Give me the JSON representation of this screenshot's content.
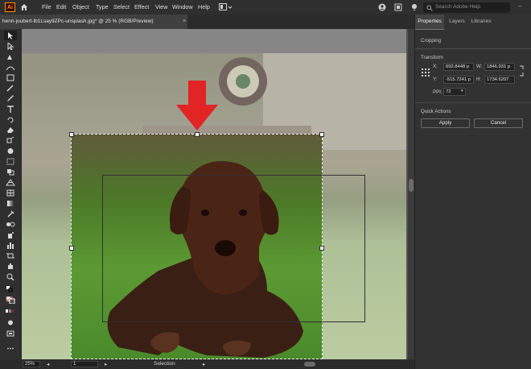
{
  "app": {
    "logo": "Ai"
  },
  "menu": [
    "File",
    "Edit",
    "Object",
    "Type",
    "Select",
    "Effect",
    "View",
    "Window",
    "Help"
  ],
  "search": {
    "placeholder": "Search Adobe Help"
  },
  "document": {
    "tab_title": "henri-joubert-lb1Lsay9ZPc-unsplash.jpg* @ 25 % (RGB/Preview)",
    "close": "×"
  },
  "status": {
    "zoom": "25%",
    "artboard": "1",
    "tool": "Selection"
  },
  "panel": {
    "tabs": [
      "Properties",
      "Layers",
      "Libraries"
    ],
    "section": "Cropping",
    "transform": {
      "title": "Transform",
      "x_label": "X:",
      "x_value": "692.8448 p",
      "y_label": "Y:",
      "y_value": "-515.7241 p",
      "w_label": "W:",
      "w_value": "1846.931 p",
      "h_label": "H:",
      "h_value": "1734.6207",
      "ppi_label": "PPI:",
      "ppi_value": "72"
    },
    "quick_actions": {
      "title": "Quick Actions",
      "apply": "Apply",
      "cancel": "Cancel"
    }
  },
  "colors": {
    "accent_arrow": "#e32424",
    "menubar": "#2f2f2f",
    "panel": "#323232"
  }
}
